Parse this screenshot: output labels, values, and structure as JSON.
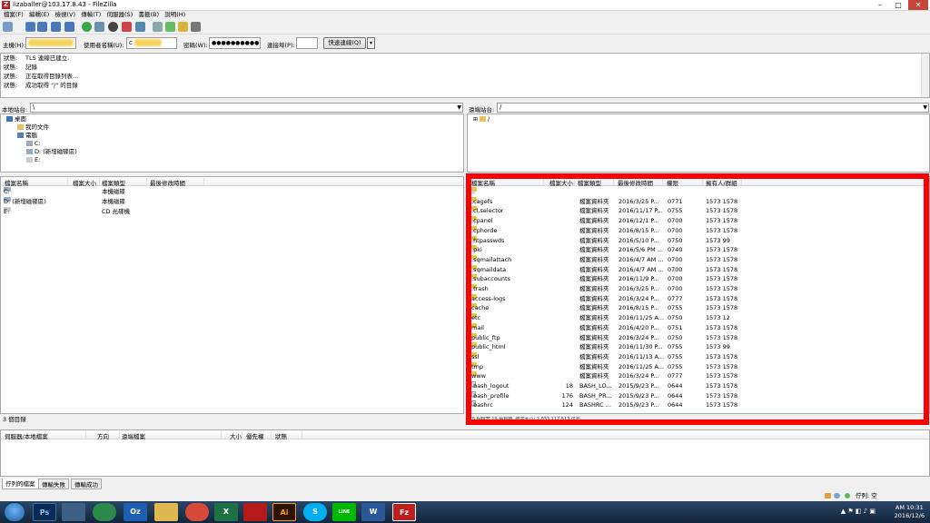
{
  "window": {
    "title": "lizaballer@103.17.8.43 - FileZilla",
    "app_icon": "filezilla-icon"
  },
  "menu": [
    "檔案(F)",
    "編輯(E)",
    "檢視(V)",
    "傳輸(T)",
    "伺服器(S)",
    "書籤(B)",
    "說明(H)"
  ],
  "quickconnect": {
    "host_label": "主機(H):",
    "user_label": "使用者名稱(U):",
    "user_prefix": "c",
    "pass_label": "密碼(W):",
    "pass_value": "●●●●●●●●●●",
    "port_label": "連接埠(P):",
    "port_value": "",
    "button": "快速連線(Q)"
  },
  "log": [
    {
      "k": "狀態:",
      "v": "TLS 連線已建立."
    },
    {
      "k": "狀態:",
      "v": "記錄"
    },
    {
      "k": "狀態:",
      "v": "正在取得目錄列表..."
    },
    {
      "k": "狀態:",
      "v": "成功取得 \"/\" 的目錄"
    }
  ],
  "local": {
    "site_label": "本地站台:",
    "site_path": "\\",
    "tree": [
      "桌面",
      "我的文件",
      "電腦",
      "C:",
      "D: (新增磁碟區)",
      "E:"
    ],
    "columns": [
      "檔案名稱",
      "檔案大小",
      "檔案類型",
      "最後修改時間"
    ],
    "rows": [
      {
        "name": "C:",
        "type": "本機磁碟"
      },
      {
        "name": "D: (新增磁碟區)",
        "type": "本機磁碟"
      },
      {
        "name": "E:",
        "type": "CD 光碟機"
      }
    ],
    "status": "3 個目錄"
  },
  "remote": {
    "site_label": "遠端站台:",
    "site_path": "/",
    "tree_root": "/",
    "columns": [
      "檔案名稱",
      "檔案大小",
      "檔案類型",
      "最後修改時間",
      "權限",
      "擁有人/群組"
    ],
    "rows": [
      {
        "name": "..",
        "size": "",
        "type": "",
        "date": "",
        "perm": "",
        "owner": "",
        "kind": "dir"
      },
      {
        "name": ".cagefs",
        "size": "",
        "type": "檔案資料夾",
        "date": "2016/3/25 P...",
        "perm": "0771",
        "owner": "1573 1578",
        "kind": "dir"
      },
      {
        "name": ".cl.selector",
        "size": "",
        "type": "檔案資料夾",
        "date": "2016/11/17 P...",
        "perm": "0755",
        "owner": "1573 1578",
        "kind": "dir"
      },
      {
        "name": ".cpanel",
        "size": "",
        "type": "檔案資料夾",
        "date": "2016/12/1 P...",
        "perm": "0700",
        "owner": "1573 1578",
        "kind": "dir"
      },
      {
        "name": ".cphorde",
        "size": "",
        "type": "檔案資料夾",
        "date": "2016/8/15 P...",
        "perm": "0700",
        "owner": "1573 1578",
        "kind": "dir"
      },
      {
        "name": ".htpasswds",
        "size": "",
        "type": "檔案資料夾",
        "date": "2016/5/10 P...",
        "perm": "0750",
        "owner": "1573 99",
        "kind": "dir"
      },
      {
        "name": ".pki",
        "size": "",
        "type": "檔案資料夾",
        "date": "2016/5/6 PM ...",
        "perm": "0740",
        "owner": "1573 1578",
        "kind": "dir"
      },
      {
        "name": ".sqmailattach",
        "size": "",
        "type": "檔案資料夾",
        "date": "2016/4/7 AM ...",
        "perm": "0700",
        "owner": "1573 1578",
        "kind": "dir"
      },
      {
        "name": ".sqmaildata",
        "size": "",
        "type": "檔案資料夾",
        "date": "2016/4/7 AM ...",
        "perm": "0700",
        "owner": "1573 1578",
        "kind": "dir"
      },
      {
        "name": ".subaccounts",
        "size": "",
        "type": "檔案資料夾",
        "date": "2016/11/9 P...",
        "perm": "0700",
        "owner": "1573 1578",
        "kind": "dir"
      },
      {
        "name": ".trash",
        "size": "",
        "type": "檔案資料夾",
        "date": "2016/3/25 P...",
        "perm": "0700",
        "owner": "1573 1578",
        "kind": "dir"
      },
      {
        "name": "access-logs",
        "size": "",
        "type": "檔案資料夾",
        "date": "2016/3/24 P...",
        "perm": "0777",
        "owner": "1573 1578",
        "kind": "dir"
      },
      {
        "name": "cache",
        "size": "",
        "type": "檔案資料夾",
        "date": "2016/8/15 P...",
        "perm": "0755",
        "owner": "1573 1578",
        "kind": "dir"
      },
      {
        "name": "etc",
        "size": "",
        "type": "檔案資料夾",
        "date": "2016/11/25 A...",
        "perm": "0750",
        "owner": "1573 12",
        "kind": "dir"
      },
      {
        "name": "mail",
        "size": "",
        "type": "檔案資料夾",
        "date": "2016/4/20 P...",
        "perm": "0751",
        "owner": "1573 1578",
        "kind": "dir"
      },
      {
        "name": "public_ftp",
        "size": "",
        "type": "檔案資料夾",
        "date": "2016/3/24 P...",
        "perm": "0750",
        "owner": "1573 1578",
        "kind": "dir"
      },
      {
        "name": "public_html",
        "size": "",
        "type": "檔案資料夾",
        "date": "2016/11/30 P...",
        "perm": "0755",
        "owner": "1573 99",
        "kind": "dir"
      },
      {
        "name": "ssl",
        "size": "",
        "type": "檔案資料夾",
        "date": "2016/11/13 A...",
        "perm": "0755",
        "owner": "1573 1578",
        "kind": "dir"
      },
      {
        "name": "tmp",
        "size": "",
        "type": "檔案資料夾",
        "date": "2016/11/25 A...",
        "perm": "0755",
        "owner": "1573 1578",
        "kind": "dir"
      },
      {
        "name": "www",
        "size": "",
        "type": "檔案資料夾",
        "date": "2016/3/24 P...",
        "perm": "0777",
        "owner": "1573 1578",
        "kind": "dir"
      },
      {
        "name": ".bash_logout",
        "size": "18",
        "type": "BASH_LO...",
        "date": "2015/9/23 P...",
        "perm": "0644",
        "owner": "1573 1578",
        "kind": "file"
      },
      {
        "name": ".bash_profile",
        "size": "176",
        "type": "BASH_PR...",
        "date": "2015/9/23 P...",
        "perm": "0644",
        "owner": "1573 1578",
        "kind": "file"
      },
      {
        "name": ".bashrc",
        "size": "124",
        "type": "BASHRC ...",
        "date": "2015/9/23 P...",
        "perm": "0644",
        "owner": "1573 1578",
        "kind": "file"
      }
    ],
    "status": "5 個檔案 19 個目錄. 總共大小: 2,033,117,513 位元"
  },
  "queue": {
    "columns": [
      "伺服器/本地檔案",
      "方向",
      "遠端檔案",
      "大小",
      "優先權",
      "狀態"
    ]
  },
  "queue_tabs": [
    "佇列的檔案",
    "傳輸失敗",
    "傳輸成功"
  ],
  "statusbar": {
    "queue": "佇列: 空"
  },
  "taskbar": {
    "time": "AM 10:31",
    "date": "2016/12/6",
    "apps": [
      "Ps",
      "",
      "",
      "Oz",
      "",
      "",
      "X",
      "",
      "Ai",
      "S",
      "LINE",
      "W",
      "Fz"
    ]
  },
  "colors": {
    "highlight": "#ff0000",
    "taskbar": "#1c3552"
  }
}
